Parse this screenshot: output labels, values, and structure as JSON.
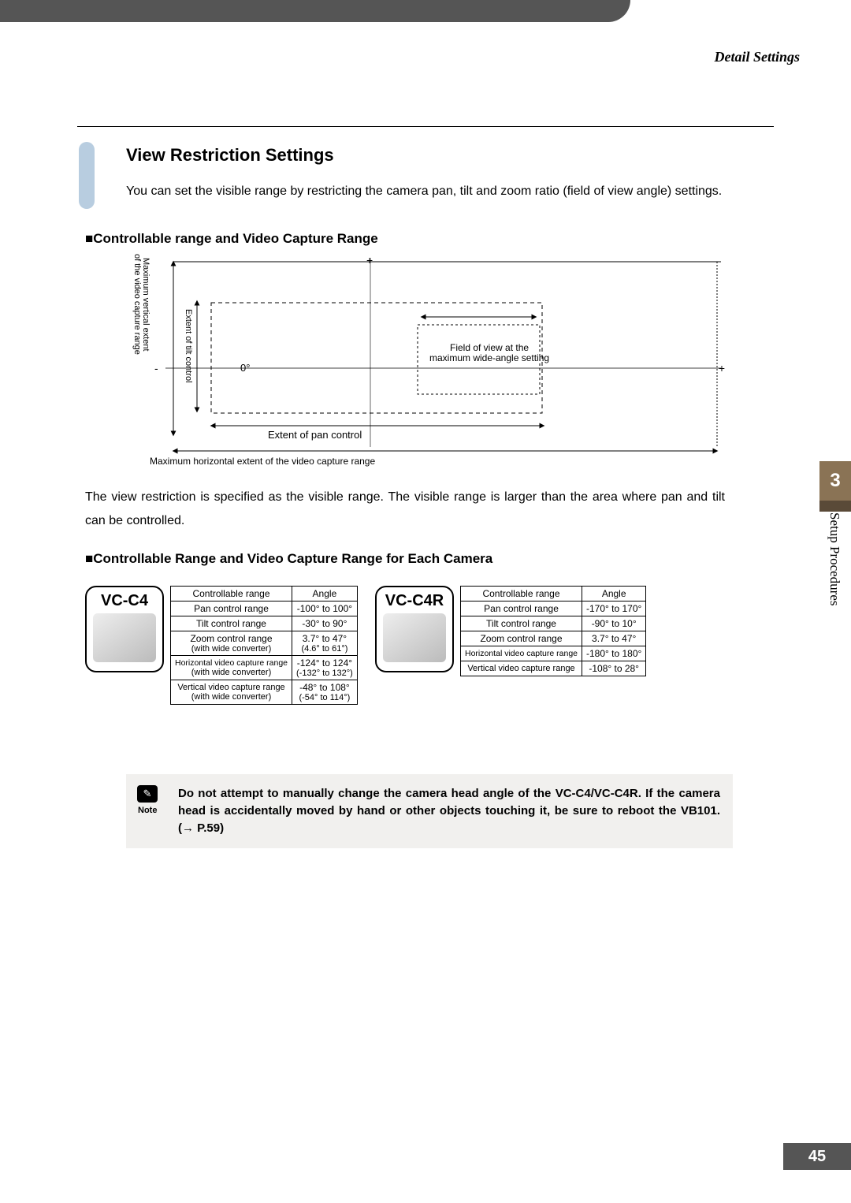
{
  "header": {
    "right": "Detail Settings"
  },
  "section": {
    "title": "View Restriction Settings",
    "intro": "You can set the visible range by restricting the camera pan, tilt and zoom ratio (field of view angle) settings.",
    "sub1": "■Controllable range and Video Capture Range",
    "sub2": "■Controllable Range and Video Capture Range for Each Camera",
    "para2": "The view restriction is specified as the visible range. The visible range is larger than the area where pan and tilt can be controlled."
  },
  "diagram": {
    "plus_top": "+",
    "plus_right": "+",
    "zero": "0°",
    "minus_left": "-",
    "pan_extent": "Extent of pan control",
    "horiz_caption": "Maximum horizontal extent of the video capture range",
    "fov": "Field of view at the\nmaximum wide-angle setting",
    "vert_label": "Maximum vertical extent\nof the video capture range",
    "tilt_label": "Extent of tilt control"
  },
  "vc_c4": {
    "title": "VC-C4",
    "headers": [
      "Controllable range",
      "Angle"
    ],
    "rows": [
      {
        "label": "Pan control range",
        "sub": "",
        "angle": "-100° to 100°",
        "angle_sub": ""
      },
      {
        "label": "Tilt control range",
        "sub": "",
        "angle": "-30° to 90°",
        "angle_sub": ""
      },
      {
        "label": "Zoom control range",
        "sub": "(with wide converter)",
        "angle": "3.7° to 47°",
        "angle_sub": "(4.6° to 61°)"
      },
      {
        "label": "Horizontal video capture range",
        "sub": "(with wide converter)",
        "angle": "-124° to 124°",
        "angle_sub": "(-132° to 132°)"
      },
      {
        "label": "Vertical video capture range",
        "sub": "(with wide converter)",
        "angle": "-48° to 108°",
        "angle_sub": "(-54° to 114°)"
      }
    ]
  },
  "vc_c4r": {
    "title": "VC-C4R",
    "headers": [
      "Controllable range",
      "Angle"
    ],
    "rows": [
      {
        "label": "Pan control range",
        "angle": "-170° to 170°"
      },
      {
        "label": "Tilt control range",
        "angle": "-90° to 10°"
      },
      {
        "label": "Zoom control range",
        "angle": "3.7° to 47°"
      },
      {
        "label": "Horizontal video capture range",
        "angle": "-180° to 180°"
      },
      {
        "label": "Vertical video capture range",
        "angle": "-108° to 28°"
      }
    ]
  },
  "note": {
    "label": "Note",
    "icon_glyph": "✎",
    "text": "Do not attempt to manually change the camera head angle of the VC-C4/VC-C4R. If the camera head is accidentally moved by hand or other objects touching it, be sure to reboot the VB101. (→ P.59)"
  },
  "side": {
    "chapter": "3",
    "label": "Setup Procedures"
  },
  "page": "45"
}
